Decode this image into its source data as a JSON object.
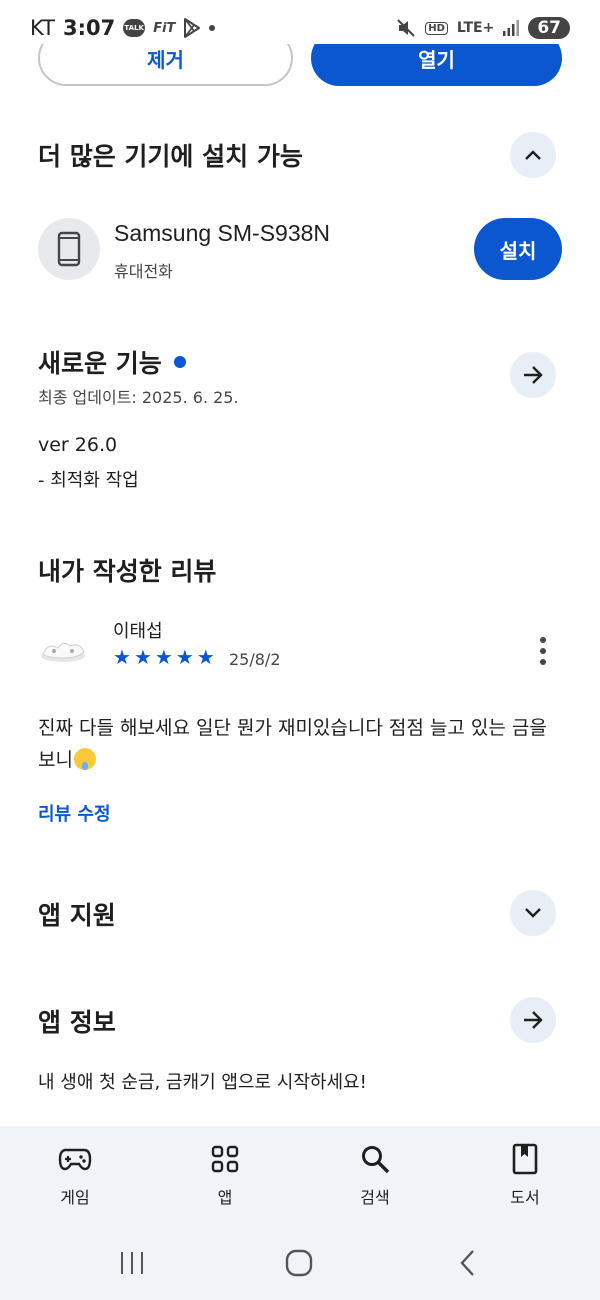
{
  "status_bar": {
    "carrier": "KT",
    "time": "3:07",
    "talk_badge": "TALK",
    "fit_badge": "FiT",
    "network": "LTE+",
    "hd_badge": "HD",
    "battery": "67",
    "icons": [
      "talk-icon",
      "fit-icon",
      "play-store-icon",
      "notification-dot-icon",
      "mute-icon",
      "hd-icon",
      "signal-icon",
      "battery-icon"
    ]
  },
  "actions": {
    "remove_label": "제거",
    "open_label": "열기"
  },
  "more_devices": {
    "title": "더 많은 기기에 설치 가능",
    "device_name": "Samsung SM-S938N",
    "device_type": "휴대전화",
    "install_label": "설치",
    "toggle_icon": "chevron-up-icon"
  },
  "whats_new": {
    "title": "새로운 기능",
    "updated": "최종 업데이트: 2025. 6. 25.",
    "version": "ver 26.0",
    "note": "- 최적화 작업",
    "arrow_icon": "arrow-right-icon"
  },
  "my_review": {
    "title": "내가 작성한 리뷰",
    "reviewer": "이태섭",
    "rating": 5,
    "date": "25/8/2",
    "text": "진짜 다들 해보세요 일단 뭔가 재미있습니다 점점 늘고 있는 금을 보니",
    "edit_label": "리뷰 수정"
  },
  "app_support": {
    "title": "앱 지원",
    "toggle_icon": "chevron-down-icon"
  },
  "app_info": {
    "title": "앱 정보",
    "description": "내 생애 첫 순금, 금캐기 앱으로 시작하세요!",
    "arrow_icon": "arrow-right-icon"
  },
  "bottom_nav": {
    "items": [
      {
        "label": "게임",
        "icon": "gamepad-icon"
      },
      {
        "label": "앱",
        "icon": "apps-grid-icon"
      },
      {
        "label": "검색",
        "icon": "search-icon"
      },
      {
        "label": "도서",
        "icon": "book-icon"
      }
    ]
  },
  "colors": {
    "accent": "#0b57d0",
    "nav_bg": "#f0f4f9",
    "chip_bg": "#e8eef5"
  }
}
